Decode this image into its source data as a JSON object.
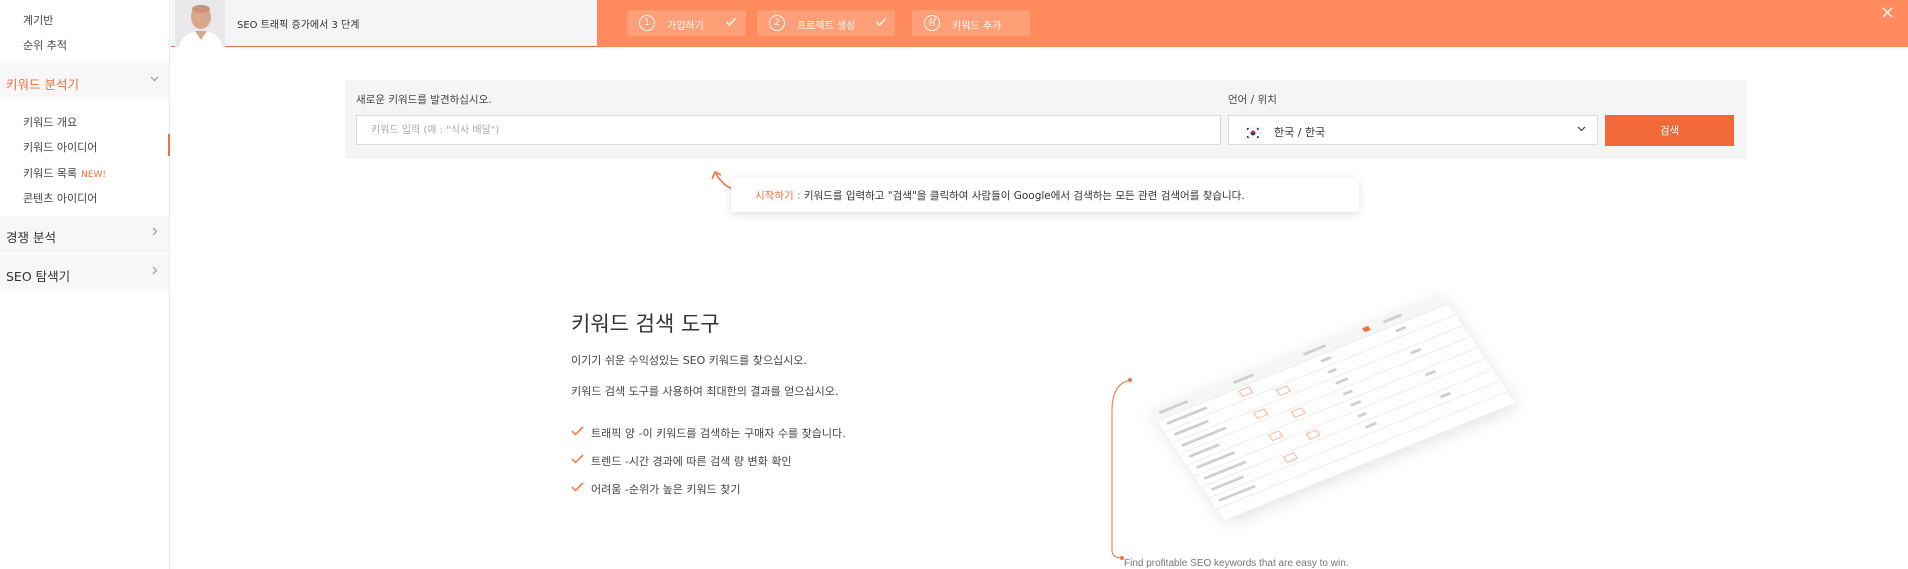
{
  "sidebar": {
    "top_items": [
      "계기반",
      "순위 추적"
    ],
    "keyword_section": {
      "label": "키워드 분석기",
      "items": [
        {
          "label": "키워드 개요"
        },
        {
          "label": "키워드 아이디어"
        },
        {
          "label": "키워드 목록",
          "badge": "NEW!"
        },
        {
          "label": "콘텐츠 아이디어"
        }
      ]
    },
    "sections": [
      {
        "label": "경쟁 분석"
      },
      {
        "label": "SEO 탐색기"
      }
    ]
  },
  "banner": {
    "title": "SEO 트래픽 증가에서 3 단계",
    "steps": [
      {
        "num": "1",
        "label": "가입하기"
      },
      {
        "num": "2",
        "label": "프로젝트 생성"
      },
      {
        "num": "삼",
        "label": "키워드 추가"
      }
    ]
  },
  "search": {
    "keyword_label": "새로운 키워드를 발견하십시오.",
    "keyword_placeholder": "키워드 입력 (예 : \"식사 배달\")",
    "location_label": "언어 / 위치",
    "location_value": "한국 / 한국",
    "button": "검색"
  },
  "hint": {
    "prefix": "시작하기 :",
    "text": " 키워드를 입력하고 \"검색\"을 클릭하여 사람들이 Google에서 검색하는 모든 관련 검색어를 찾습니다."
  },
  "hero": {
    "title": "키워드 검색 도구",
    "paragraph1": "이기기 쉬운 수익성있는 SEO 키워드를 찾으십시오.",
    "paragraph2": "키워드 검색 도구를 사용하여 최대한의 결과를 얻으십시오.",
    "features": [
      "트래픽 양 -이 키워드를 검색하는 구매자 수를 찾습니다.",
      "트렌드 -시간 경과에 따른 검색 량 변화 확인",
      "어려움 -순위가 높은 키워드 찾기"
    ]
  },
  "illustration": {
    "caption": "Find profitable SEO keywords that are easy to win."
  },
  "colors": {
    "accent": "#f26938",
    "banner": "#ff8a5b"
  }
}
